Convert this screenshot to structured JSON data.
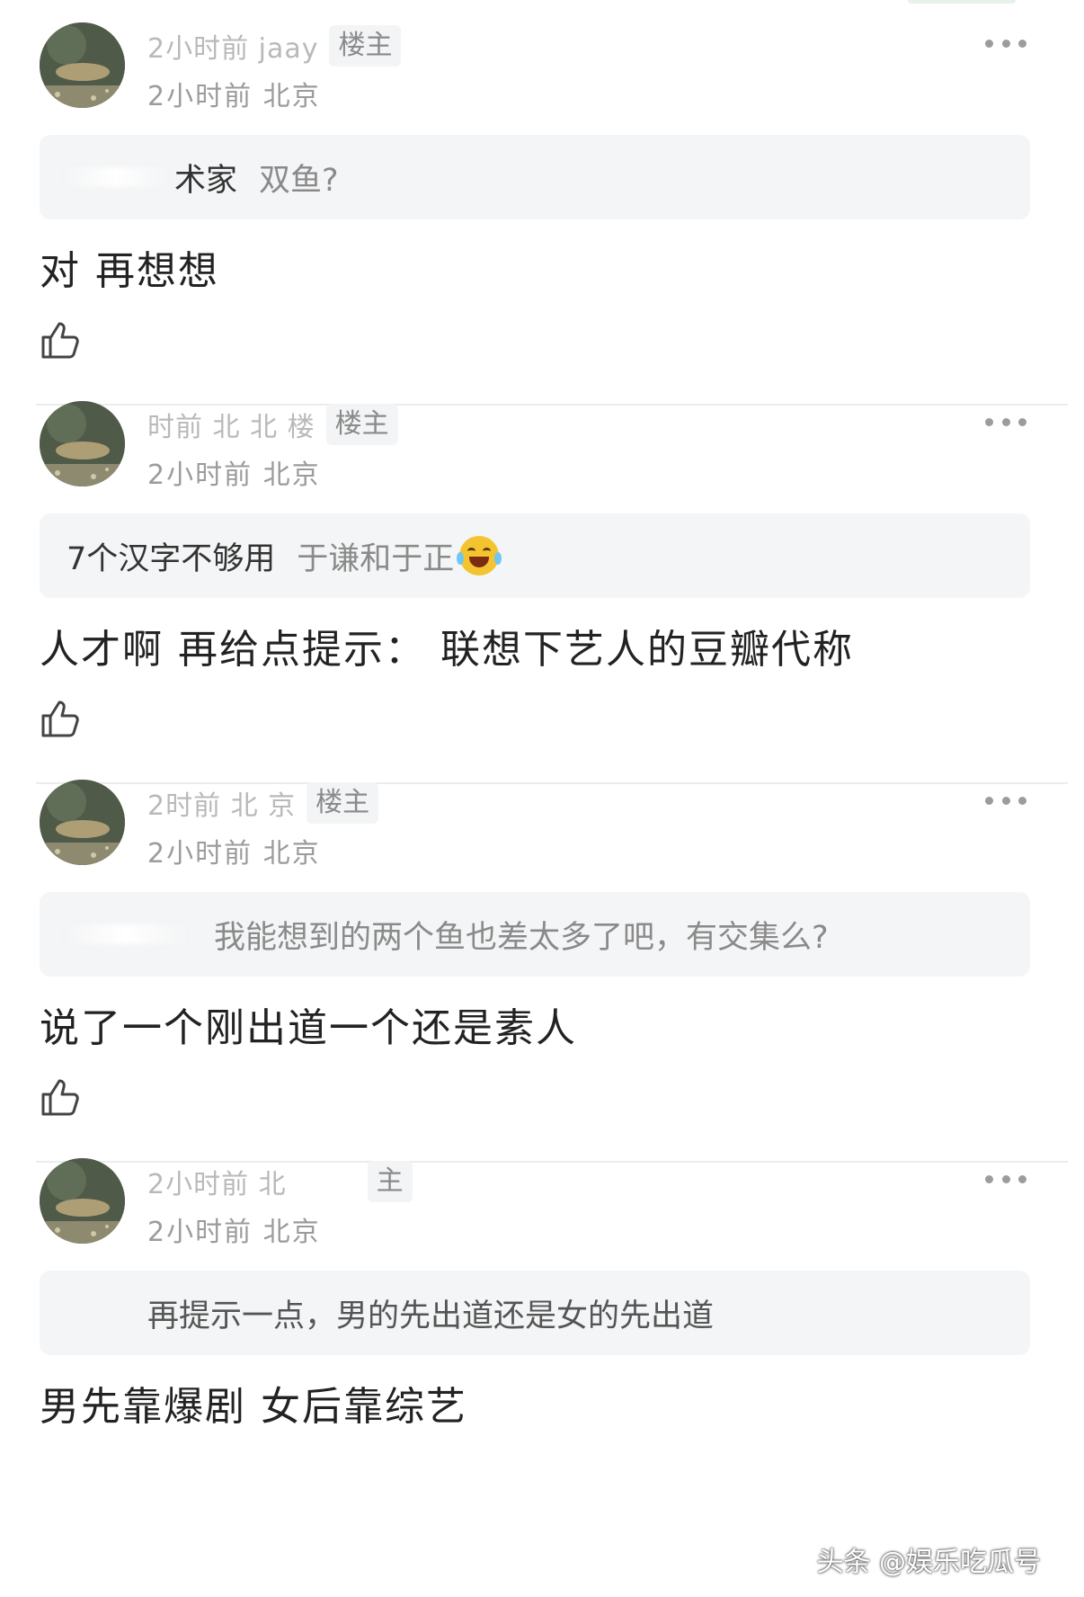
{
  "comments": [
    {
      "name": "2小时前 jaay",
      "owner_badge": "楼主",
      "meta": "2小时前 北京",
      "quote": {
        "strong": "术家",
        "light": "双鱼?",
        "emoji": false
      },
      "body": "对 再想想"
    },
    {
      "name": "时前 北 北 楼",
      "owner_badge": "楼主",
      "meta": "2小时前 北京",
      "quote": {
        "strong": "7个汉字不够用",
        "light": "于谦和于正",
        "emoji": true
      },
      "body": "人才啊  再给点提示： 联想下艺人的豆瓣代称"
    },
    {
      "name": "2时前 北     京",
      "owner_badge": "楼主",
      "meta": "2小时前 北京",
      "quote": {
        "strong": "",
        "light": "我能想到的两个鱼也差太多了吧，有交集么?",
        "emoji": false
      },
      "body": "说了一个刚出道一个还是素人"
    },
    {
      "name": "2小时前 北",
      "owner_badge": "主",
      "meta": "2小时前 北京",
      "quote": {
        "strong": "",
        "light": "再提示一点，男的先出道还是女的先出道",
        "emoji": false
      },
      "body": "男先靠爆剧  女后靠综艺"
    }
  ],
  "watermark": "头条 @娱乐吃瓜号",
  "icons": [
    "more-icon",
    "like-icon",
    "avatar-fish"
  ],
  "colors": {
    "quote_bg": "#f4f5f6",
    "badge_bg": "#f3f4f5",
    "meta": "#9b9b9b"
  }
}
